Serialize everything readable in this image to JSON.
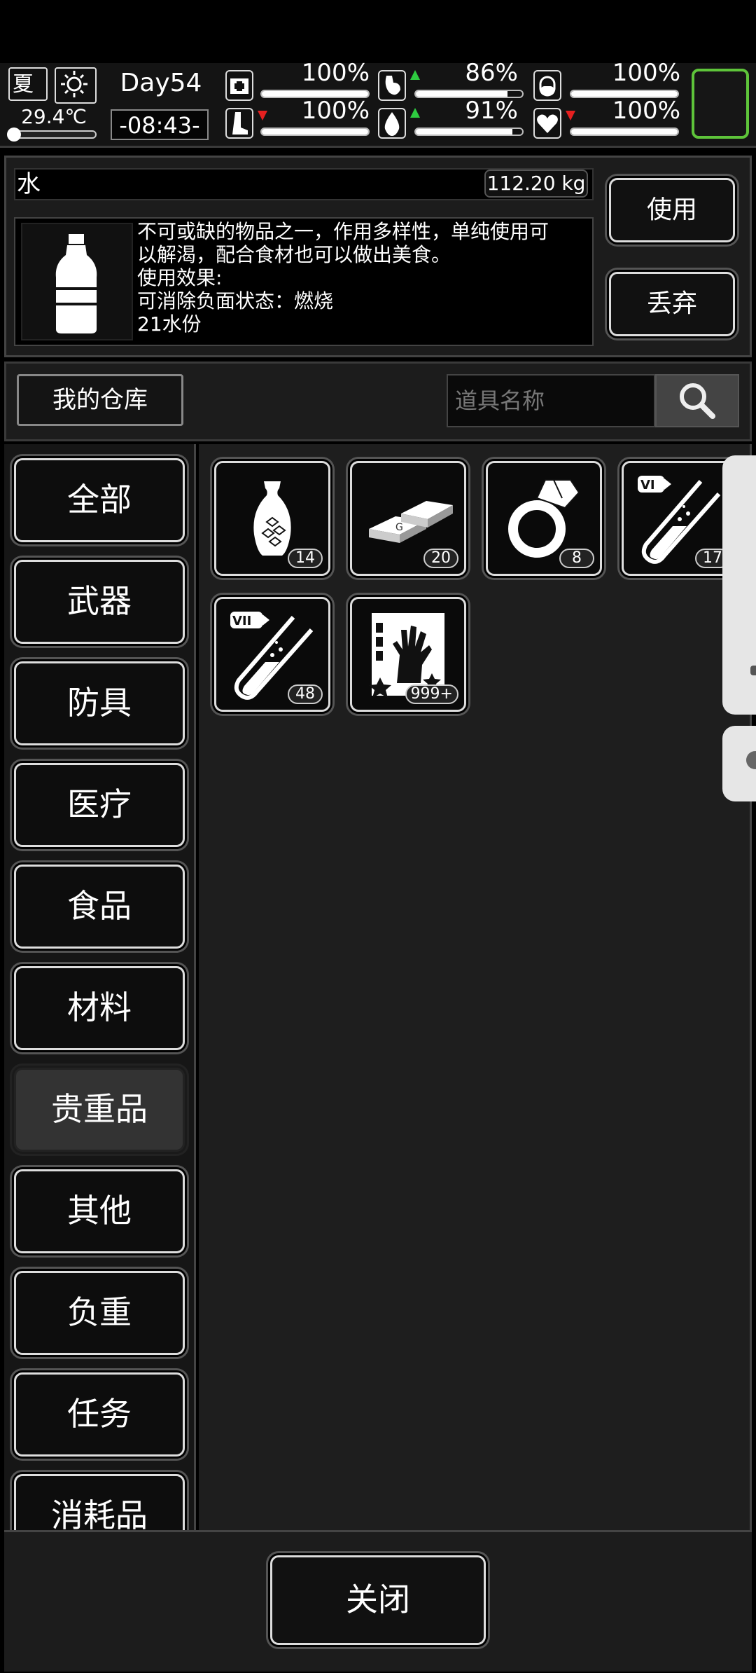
{
  "status": {
    "season": "夏",
    "temperature": "29.4℃",
    "day": "Day54",
    "time": "-08:43-",
    "stats": [
      {
        "name": "health",
        "icon": "medkit-icon",
        "percent": "100%",
        "level": 1.0,
        "trend": "none"
      },
      {
        "name": "hunger",
        "icon": "stomach-icon",
        "percent": "86%",
        "level": 0.86,
        "trend": "up"
      },
      {
        "name": "stamina",
        "icon": "pill-icon",
        "percent": "100%",
        "level": 1.0,
        "trend": "none"
      },
      {
        "name": "leg",
        "icon": "leg-icon",
        "percent": "100%",
        "level": 1.0,
        "trend": "down"
      },
      {
        "name": "thirst",
        "icon": "water-drop-icon",
        "percent": "91%",
        "level": 0.91,
        "trend": "up"
      },
      {
        "name": "mood",
        "icon": "heart-icon",
        "percent": "100%",
        "level": 1.0,
        "trend": "down"
      }
    ]
  },
  "detail": {
    "item_name": "水",
    "weight": "112.20 kg",
    "description_lines": [
      "不可或缺的物品之一，作用多样性，单纯使用可",
      "以解渴，配合食材也可以做出美食。",
      "使用效果:",
      "可消除负面状态：燃烧",
      "21水份"
    ],
    "use_label": "使用",
    "drop_label": "丢弃"
  },
  "warehouse": {
    "title": "我的仓库",
    "search_placeholder": "道具名称"
  },
  "categories": [
    "全部",
    "武器",
    "防具",
    "医疗",
    "食品",
    "材料",
    "贵重品",
    "其他",
    "负重",
    "任务",
    "消耗品"
  ],
  "active_category": "贵重品",
  "items": [
    {
      "icon": "vase-icon",
      "count": "14"
    },
    {
      "icon": "gold-bars-icon",
      "count": "20"
    },
    {
      "icon": "diamond-ring-icon",
      "count": "8"
    },
    {
      "icon": "test-tube-vi-icon",
      "count": "17",
      "tag": "VI"
    },
    {
      "icon": "test-tube-vii-icon",
      "count": "48",
      "tag": "VII"
    },
    {
      "icon": "zombie-hand-card-icon",
      "count": "999+"
    }
  ],
  "close_label": "关闭"
}
